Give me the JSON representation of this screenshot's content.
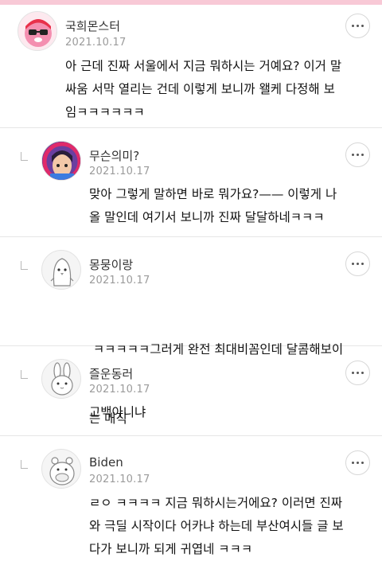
{
  "comments": [
    {
      "nickname": "국희몬스터",
      "date": "2021.10.17",
      "lines": [
        "아 근데 진짜 서울에서 지금 뭐하시는 거예요? 이거 말",
        "싸움 서막 열리는 건데 이렇게 보니까 왤케 다정해 보",
        "임ㅋㅋㅋㅋㅋㅋ"
      ],
      "avatar": "pink-monster-avatar"
    },
    {
      "nickname": "무슨의미?",
      "date": "2021.10.17",
      "lines": [
        "맞아 그렇게 말하면 바로 뭐가요?—— 이렇게 나",
        "올 말인데 여기서 보니까 진짜 달달하네ㅋㅋㅋ"
      ],
      "avatar": "cartoon-girl-avatar"
    },
    {
      "nickname": "몽뭉이랑",
      "date": "2021.10.17",
      "lines": [
        " ㅋㅋㅋㅋㅋ그러게 완전 최대비꼼인데 달콤해보이",
        "는 매직"
      ],
      "avatar": "penguin-avatar"
    },
    {
      "nickname": "즐운동러",
      "date": "2021.10.17",
      "lines": [
        "고백아니냐"
      ],
      "avatar": "rabbit-avatar"
    },
    {
      "nickname": "Biden",
      "date": "2021.10.17",
      "lines": [
        "ㄹㅇ ㅋㅋㅋㅋ 지금 뭐하시는거에요? 이러면 진짜",
        "와 극딜 시작이다 어카냐 하는데 부산여시들 글 보",
        "다가 보니까 되게 귀엽네 ㅋㅋㅋ"
      ],
      "avatar": "hippo-avatar"
    }
  ],
  "colors": {
    "accent_pink": "#f8c9d6",
    "divider": "#e6e6e6",
    "date_gray": "#9b9b9b"
  }
}
